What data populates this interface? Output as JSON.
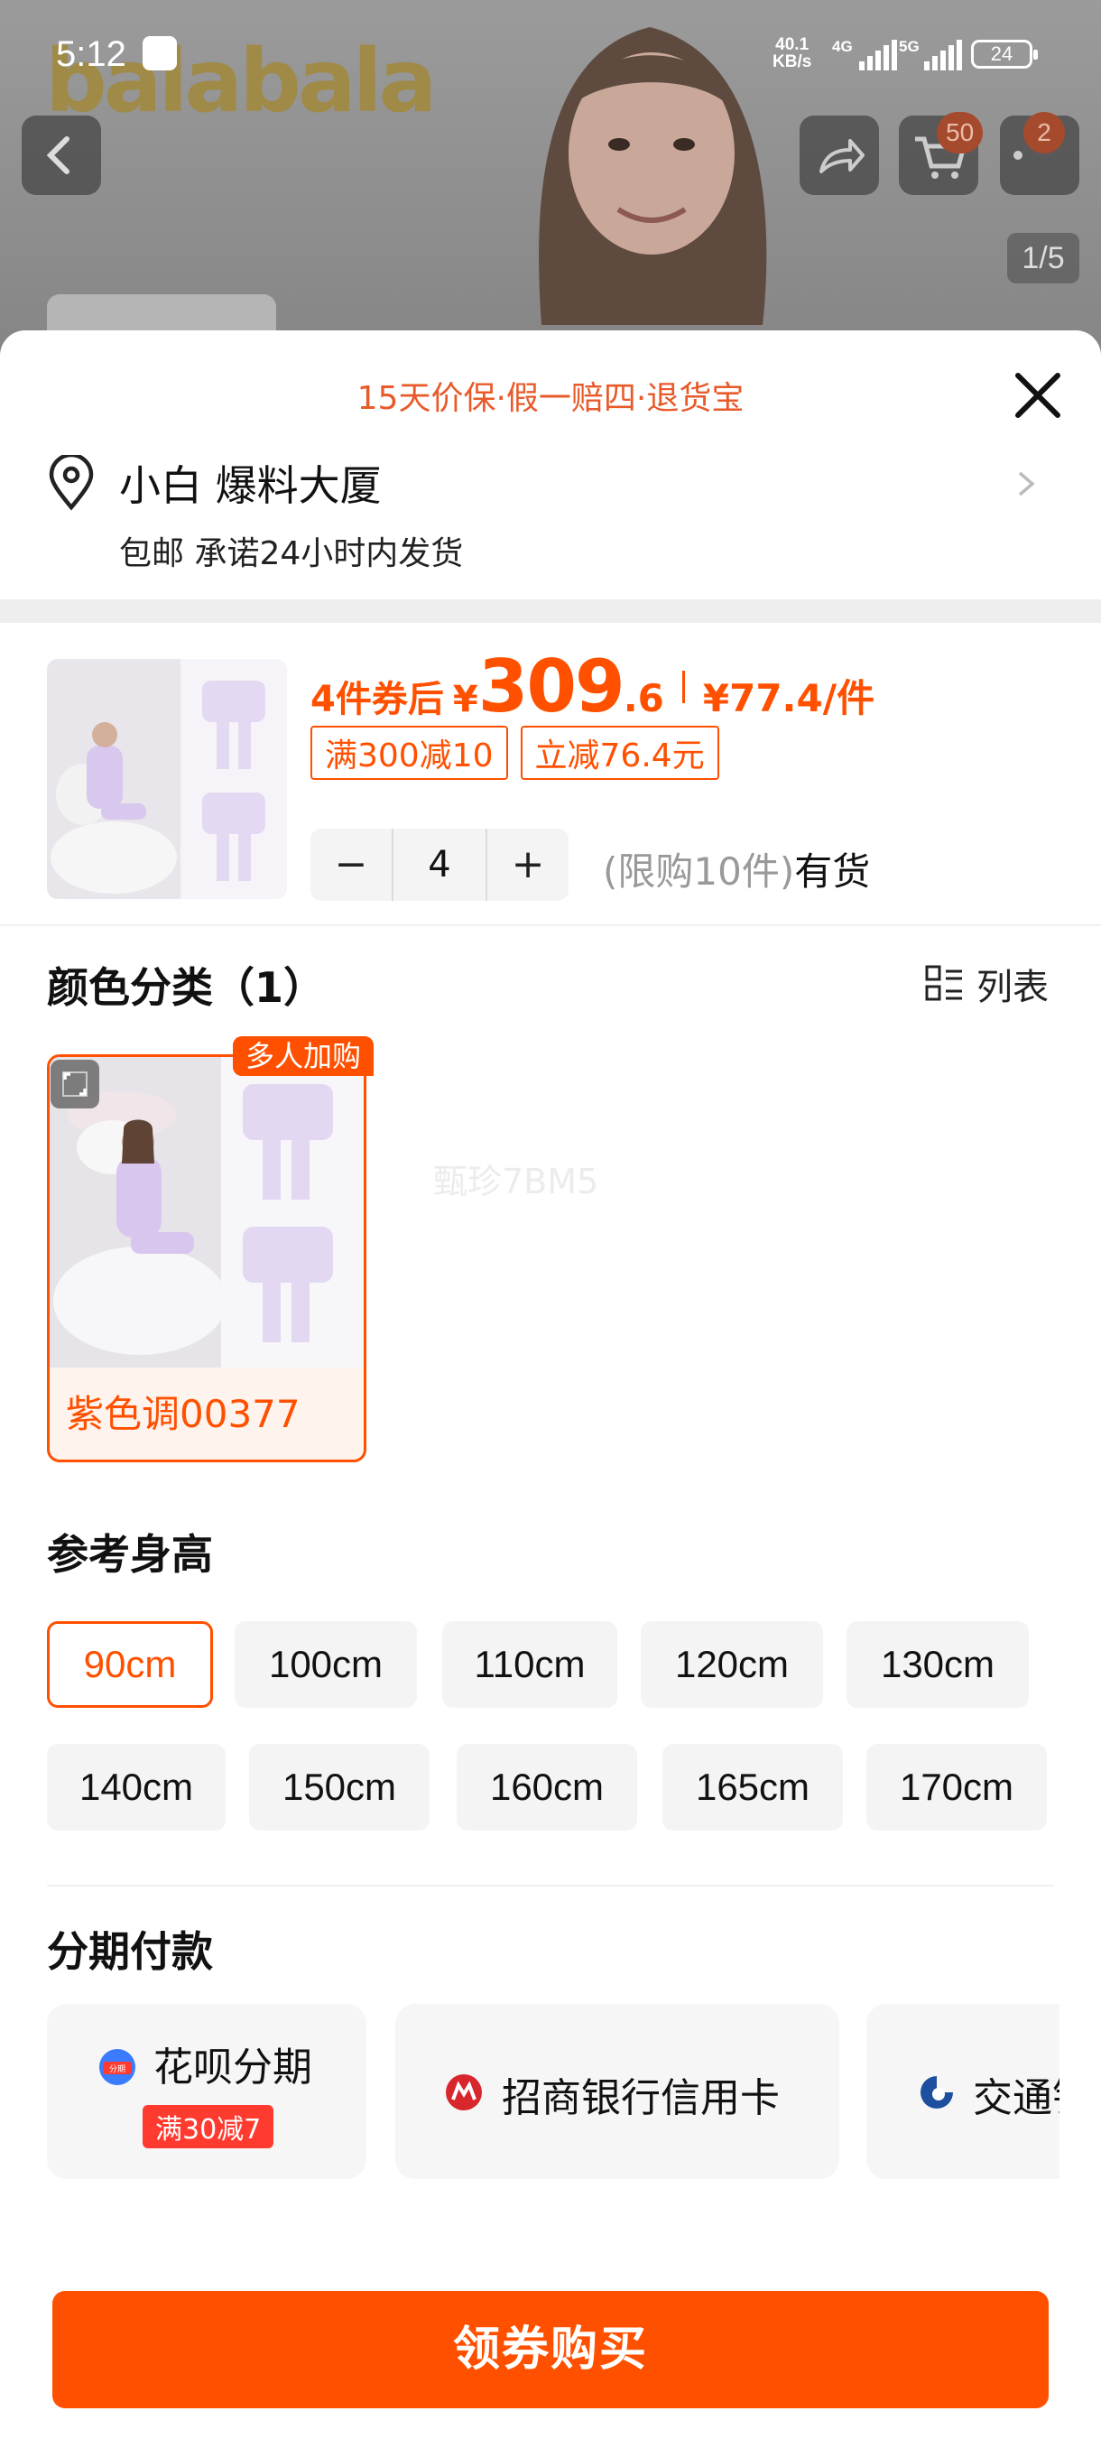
{
  "status_bar": {
    "time": "5:12",
    "net_speed_value": "40.1",
    "net_speed_unit": "KB/s",
    "signal_1": "4G",
    "signal_2": "5G",
    "battery": "24"
  },
  "background": {
    "brand": "balabala",
    "cart_badge": "50",
    "message_badge": "2",
    "pager": "1/5"
  },
  "sheet": {
    "guarantee": "15天价保·假一赔四·退货宝",
    "address": {
      "name": "小白 爆料大厦",
      "delivery": "包邮 承诺24小时内发货"
    },
    "price": {
      "label": "4件券后",
      "currency": "¥",
      "integer": "309",
      "decimal": ".6",
      "unit_price": "¥77.4/件",
      "tags": [
        "满300减10",
        "立减76.4元"
      ]
    },
    "quantity": {
      "minus": "−",
      "value": "4",
      "plus": "+"
    },
    "stock": {
      "limit": "(限购10件)",
      "availability": "有货"
    },
    "color_section": {
      "title": "颜色分类（1）",
      "list_toggle": "列表",
      "options": [
        {
          "label": "紫色调00377",
          "badge": "多人加购",
          "selected": true
        }
      ]
    },
    "watermark": "甄珍7BM5",
    "size_section": {
      "title": "参考身高",
      "options": [
        "90cm",
        "100cm",
        "110cm",
        "120cm",
        "130cm",
        "140cm",
        "150cm",
        "160cm",
        "165cm",
        "170cm"
      ],
      "selected": "90cm"
    },
    "installment_section": {
      "title": "分期付款",
      "options": [
        {
          "name": "花呗分期",
          "icon_text": "分期",
          "tag": "满30减7"
        },
        {
          "name": "招商银行信用卡"
        },
        {
          "name": "交通银"
        }
      ]
    },
    "cta": "领券购买"
  },
  "colors": {
    "accent": "#ff5000",
    "guarantee_text": "#e85a2a",
    "tag_red": "#ff3b30"
  }
}
